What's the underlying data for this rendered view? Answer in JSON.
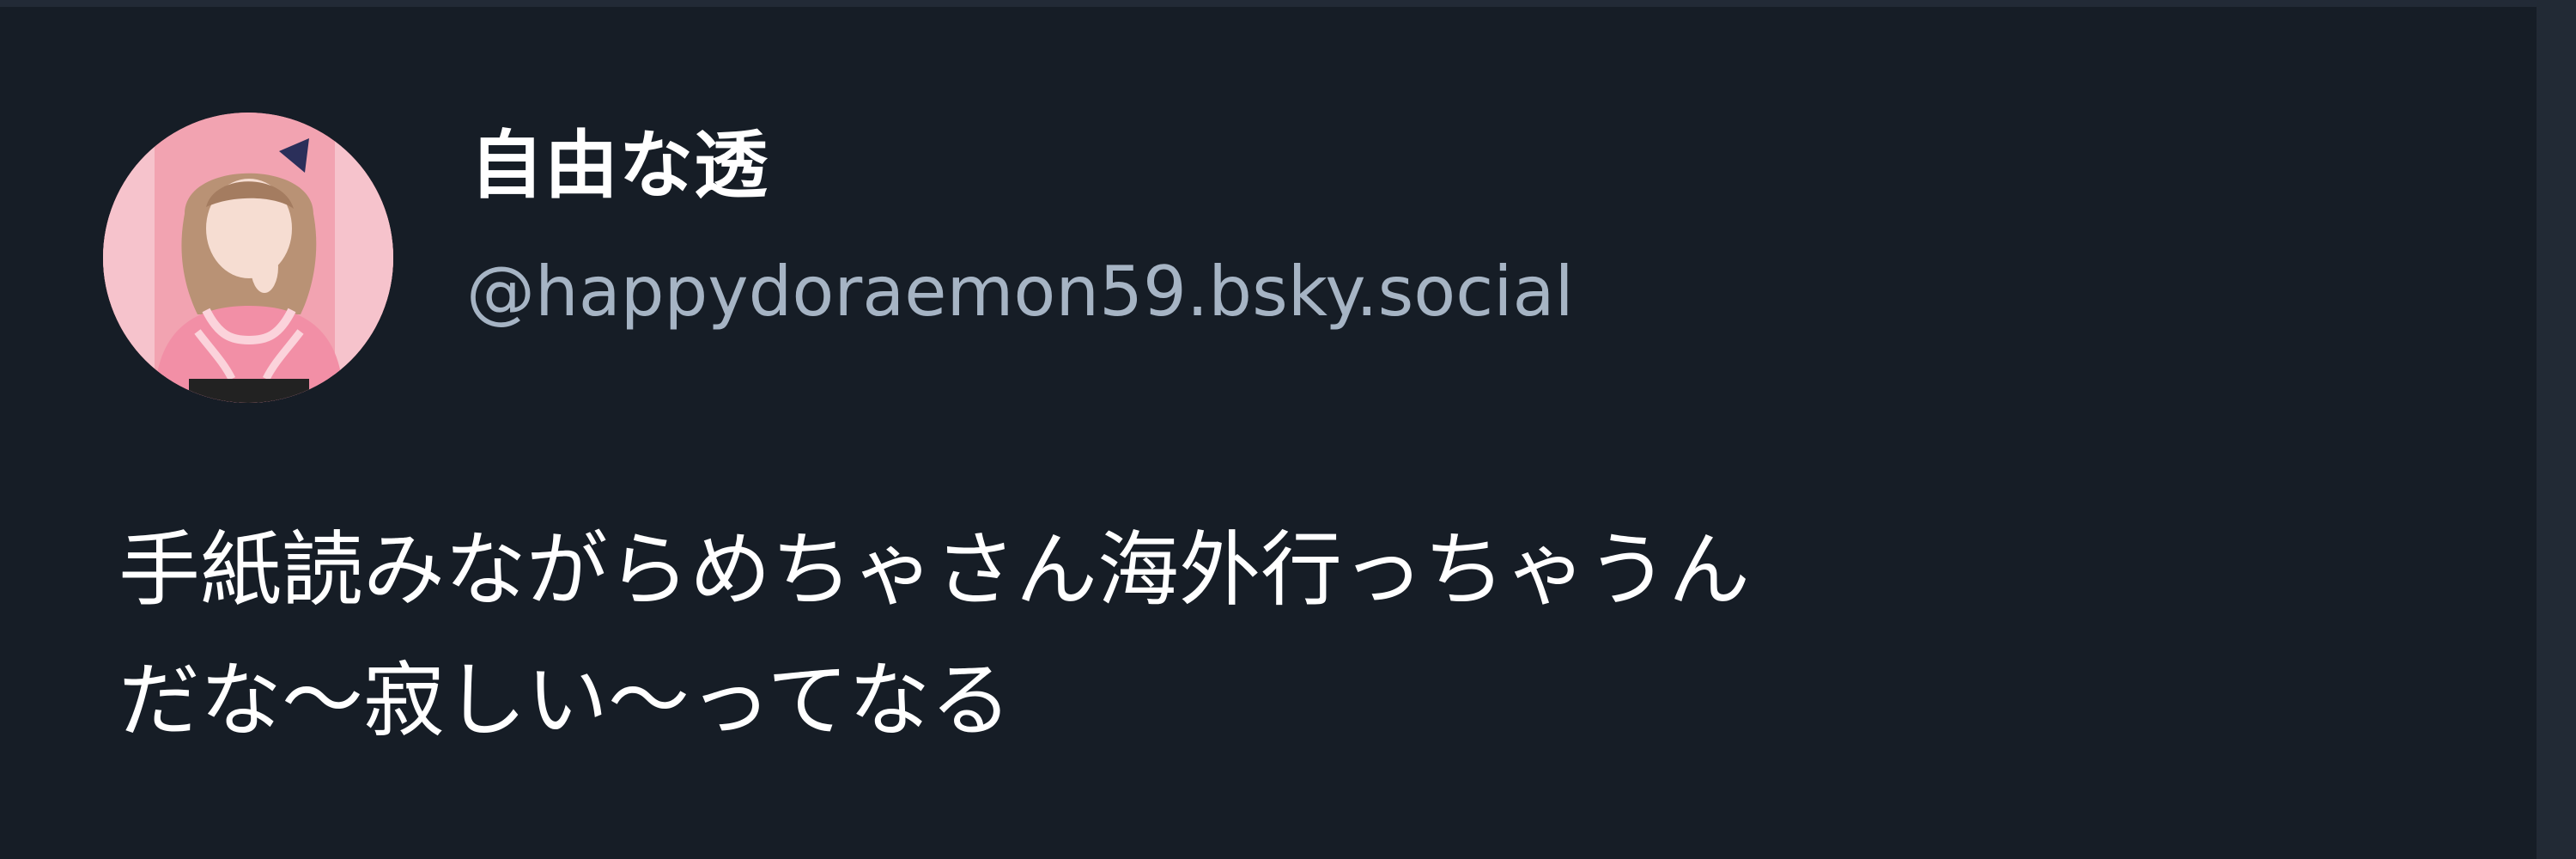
{
  "author": {
    "display_name": "自由な透",
    "handle": "@happydoraemon59.bsky.social",
    "avatar_icon": "profile-avatar-icon"
  },
  "post": {
    "text_lines": [
      "手紙読みながらめちゃさん海外行っちゃうん",
      "だな〜寂しい〜ってなる"
    ]
  },
  "colors": {
    "background": "#161d26",
    "handle": "#a6b4c4",
    "text": "#ffffff"
  }
}
